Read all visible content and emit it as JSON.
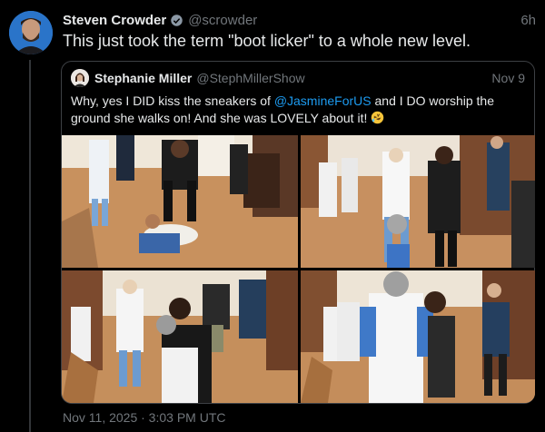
{
  "tweet": {
    "author_name": "Steven Crowder",
    "author_handle": "@scrowder",
    "relative_time": "6h",
    "text": "This just took the term \"boot licker\" to a whole new level.",
    "timestamp": "Nov 11, 2025 · 3:03 PM UTC"
  },
  "quote": {
    "author_name": "Stephanie Miller",
    "author_handle": "@StephMillerShow",
    "date": "Nov 9",
    "text_part1": "Why, yes I DID kiss the sneakers of ",
    "mention": "@JasmineForUS",
    "text_part2": " and I DO worship the ground she walks on! And she was LOVELY about it! ",
    "emoji": "rolling-on-floor-laughing-emoji"
  },
  "icons": {
    "verified": "verified-badge-icon"
  },
  "colors": {
    "background": "#000000",
    "text": "#e7e9ea",
    "muted": "#71767b",
    "link": "#1d9bf0",
    "border": "#3d4044"
  }
}
